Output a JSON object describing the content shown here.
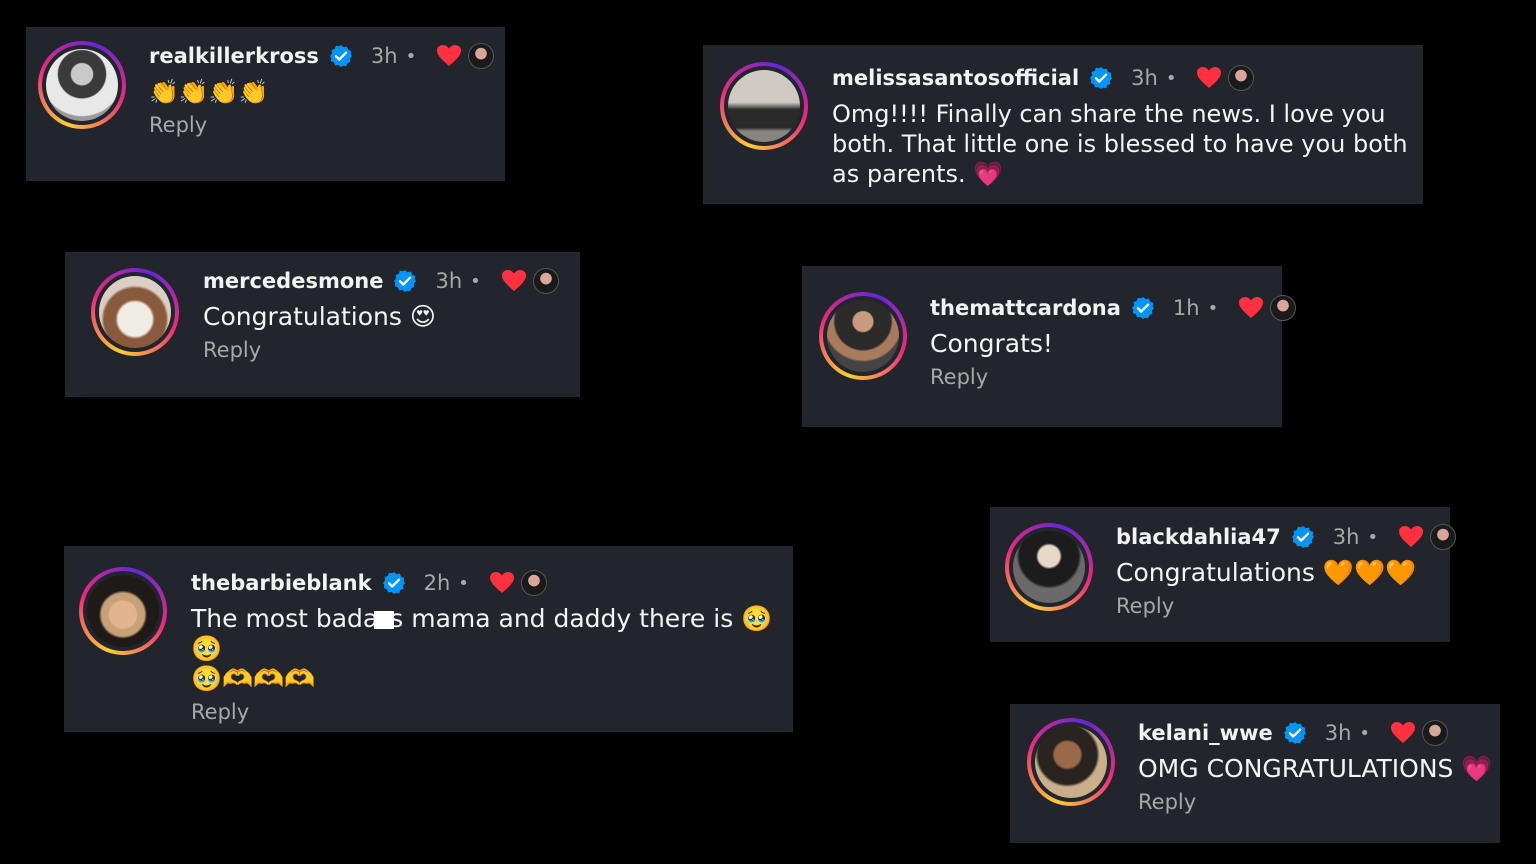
{
  "comments": [
    {
      "username": "realkillerkross",
      "time": "3h",
      "dot": "•",
      "text": "👏👏👏👏",
      "reply": "Reply"
    },
    {
      "username": "melissasantosofficial",
      "time": "3h",
      "dot": "•",
      "text": "Omg!!!! Finally can share the news. I love you both. That little one is blessed to have you both as parents. 💗",
      "reply": "Reply"
    },
    {
      "username": "mercedesmone",
      "time": "3h",
      "dot": "•",
      "text": "Congratulations 😍",
      "reply": "Reply"
    },
    {
      "username": "themattcardona",
      "time": "1h",
      "dot": "•",
      "text": "Congrats!",
      "reply": "Reply"
    },
    {
      "username": "thebarbieblank",
      "time": "2h",
      "dot": "•",
      "text_part1": "The most bada",
      "text_part2": "s mama and daddy there is 🥹🥹",
      "text_line2": "🥹🫶🫶🫶",
      "reply": "Reply"
    },
    {
      "username": "blackdahlia47",
      "time": "3h",
      "dot": "•",
      "text": "Congratulations 🧡🧡🧡",
      "reply": "Reply"
    },
    {
      "username": "kelani_wwe",
      "time": "3h",
      "dot": "•",
      "text": "OMG CONGRATULATIONS 💗",
      "reply": "Reply"
    }
  ],
  "icons": {
    "verified": "verified-badge-icon",
    "heart": "heart-icon",
    "liker": "liker-avatar-icon"
  },
  "colors": {
    "background": "#000000",
    "card": "#22252c",
    "verified": "#0095f6",
    "heart": "#ff3040",
    "muted": "#a8a8a8"
  }
}
